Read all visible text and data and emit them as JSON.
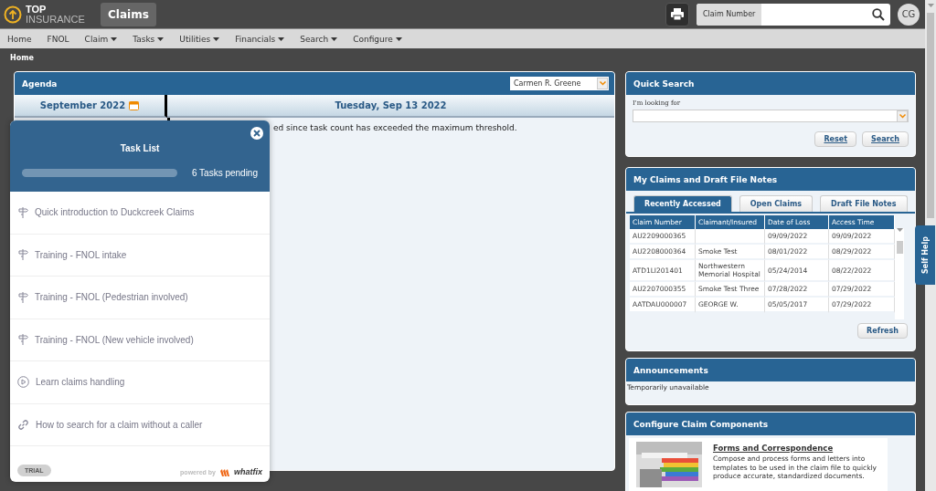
{
  "header": {
    "logo_top": "TOP",
    "logo_bottom": "INSURANCE",
    "app_tab": "Claims",
    "search_label": "Claim Number",
    "avatar": "CG"
  },
  "menu": [
    {
      "label": "Home",
      "dropdown": false
    },
    {
      "label": "FNOL",
      "dropdown": false
    },
    {
      "label": "Claim",
      "dropdown": true
    },
    {
      "label": "Tasks",
      "dropdown": true
    },
    {
      "label": "Utilities",
      "dropdown": true
    },
    {
      "label": "Financials",
      "dropdown": true
    },
    {
      "label": "Search",
      "dropdown": true
    },
    {
      "label": "Configure",
      "dropdown": true
    }
  ],
  "breadcrumb": "Home",
  "agenda": {
    "title": "Agenda",
    "user": "Carmen R. Greene",
    "month": "September 2022",
    "day": "Tuesday, Sep 13 2022",
    "message": "ed since task count has exceeded the maximum threshold."
  },
  "quick_search": {
    "title": "Quick Search",
    "label": "I'm looking for",
    "buttons": [
      "Reset",
      "Search"
    ]
  },
  "my_claims": {
    "title": "My Claims and Draft File Notes",
    "tabs": [
      {
        "label": "Recently Accessed",
        "selected": true
      },
      {
        "label": "Open Claims",
        "selected": false
      },
      {
        "label": "Draft File Notes",
        "selected": false
      }
    ],
    "columns": [
      "Claim Number",
      "Claimant/Insured",
      "Date of Loss",
      "Access Time"
    ],
    "rows": [
      {
        "claim_number": "AU2209000365",
        "date_of_loss": "09/09/2022",
        "access_time": "09/09/2022"
      },
      {
        "claim_number": "AU2208000364",
        "claimant": "Smoke Test",
        "date_of_loss": "08/01/2022",
        "access_time": "08/29/2022"
      },
      {
        "claim_number": "ATD1LI201401",
        "claimant": "Northwestern Memorial Hospital",
        "date_of_loss": "05/24/2014",
        "access_time": "08/22/2022"
      },
      {
        "claim_number": "AU2207000355",
        "claimant": "Smoke Test Three",
        "date_of_loss": "07/28/2022",
        "access_time": "07/29/2022"
      },
      {
        "claim_number": "AATDAU000007",
        "claimant": "GEORGE W.",
        "date_of_loss": "05/05/2017",
        "access_time": "07/29/2022"
      }
    ],
    "refresh": "Refresh"
  },
  "announcements": {
    "title": "Announcements",
    "text": "Temporarily unavailable"
  },
  "configure": {
    "title": "Configure Claim Components",
    "items": [
      {
        "kind": "picture",
        "title": "Forms and Correspondence",
        "description": "Compose and process forms and letters into templates to be used in the claim file to quickly produce accurate, standardized documents."
      }
    ]
  },
  "self_help": "Self Help",
  "task_list": {
    "title": "Task List",
    "level": 0,
    "pending": "6 Tasks pending",
    "tasks": [
      {
        "kind": "flow",
        "label": "Quick introduction to Duckcreek Claims"
      },
      {
        "kind": "flow",
        "label": "Training - FNOL intake"
      },
      {
        "kind": "flow",
        "label": "Training - FNOL (Pedestrian involved)"
      },
      {
        "kind": "flow",
        "label": "Training - FNOL (New vehicle involved)"
      },
      {
        "kind": "video",
        "label": "Learn claims handling"
      },
      {
        "kind": "link",
        "label": "How to search for a claim without a caller"
      }
    ],
    "trial": "TRIAL",
    "powered_by": "powered by",
    "brand": "whatfix"
  }
}
